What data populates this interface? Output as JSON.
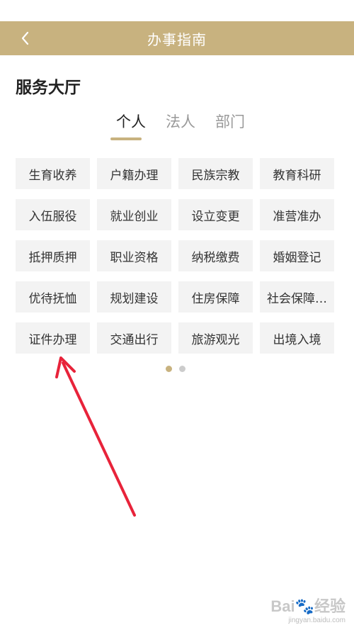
{
  "header": {
    "title": "办事指南",
    "back_icon": "chevron-left-icon"
  },
  "section": {
    "title": "服务大厅"
  },
  "tabs": [
    {
      "label": "个人",
      "active": true
    },
    {
      "label": "法人",
      "active": false
    },
    {
      "label": "部门",
      "active": false
    }
  ],
  "categories": [
    "生育收养",
    "户籍办理",
    "民族宗教",
    "教育科研",
    "入伍服役",
    "就业创业",
    "设立变更",
    "准营准办",
    "抵押质押",
    "职业资格",
    "纳税缴费",
    "婚姻登记",
    "优待抚恤",
    "规划建设",
    "住房保障",
    "社会保障…",
    "证件办理",
    "交通出行",
    "旅游观光",
    "出境入境"
  ],
  "pagination": {
    "pages": 2,
    "current": 1
  },
  "annotation": {
    "icon": "red-arrow-annotation",
    "color": "#e8233a"
  },
  "watermark": {
    "logo": "Bai🐾经验",
    "url": "jingyan.baidu.com"
  },
  "colors": {
    "accent": "#c8b27f",
    "cell_bg": "#f3f3f3"
  }
}
